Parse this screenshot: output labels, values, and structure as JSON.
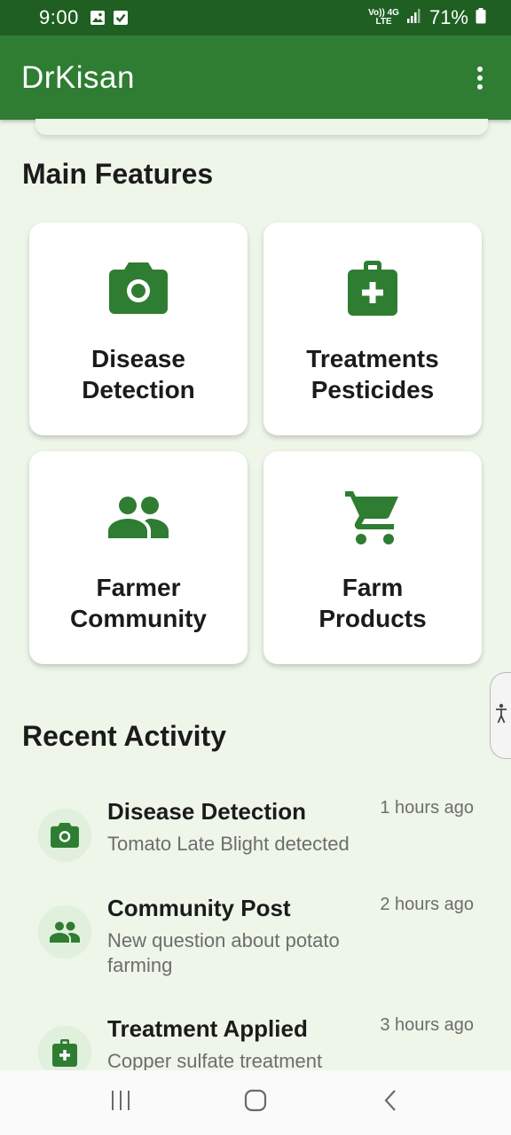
{
  "status_bar": {
    "time": "9:00",
    "network_top": "Vo)) 4G",
    "network_bottom": "LTE",
    "battery": "71%"
  },
  "app_bar": {
    "title": "DrKisan"
  },
  "main_features": {
    "title": "Main Features",
    "cards": [
      {
        "line1": "Disease",
        "line2": "Detection",
        "icon": "camera-icon"
      },
      {
        "line1": "Treatments",
        "line2": "Pesticides",
        "icon": "medical-bag-icon"
      },
      {
        "line1": "Farmer",
        "line2": "Community",
        "icon": "people-icon"
      },
      {
        "line1": "Farm",
        "line2": "Products",
        "icon": "cart-icon"
      }
    ]
  },
  "recent_activity": {
    "title": "Recent Activity",
    "items": [
      {
        "title": "Disease Detection",
        "time": "1 hours ago",
        "description": "Tomato Late Blight detected",
        "icon": "camera-icon"
      },
      {
        "title": "Community Post",
        "time": "2 hours ago",
        "description": "New question about potato farming",
        "icon": "people-icon"
      },
      {
        "title": "Treatment Applied",
        "time": "3 hours ago",
        "description": "Copper sulfate treatment",
        "icon": "medical-bag-icon"
      }
    ]
  },
  "colors": {
    "primary": "#2e7d32",
    "status_bar": "#1f5f22",
    "background": "#eef5e9",
    "icon_green": "#2e7d32"
  }
}
